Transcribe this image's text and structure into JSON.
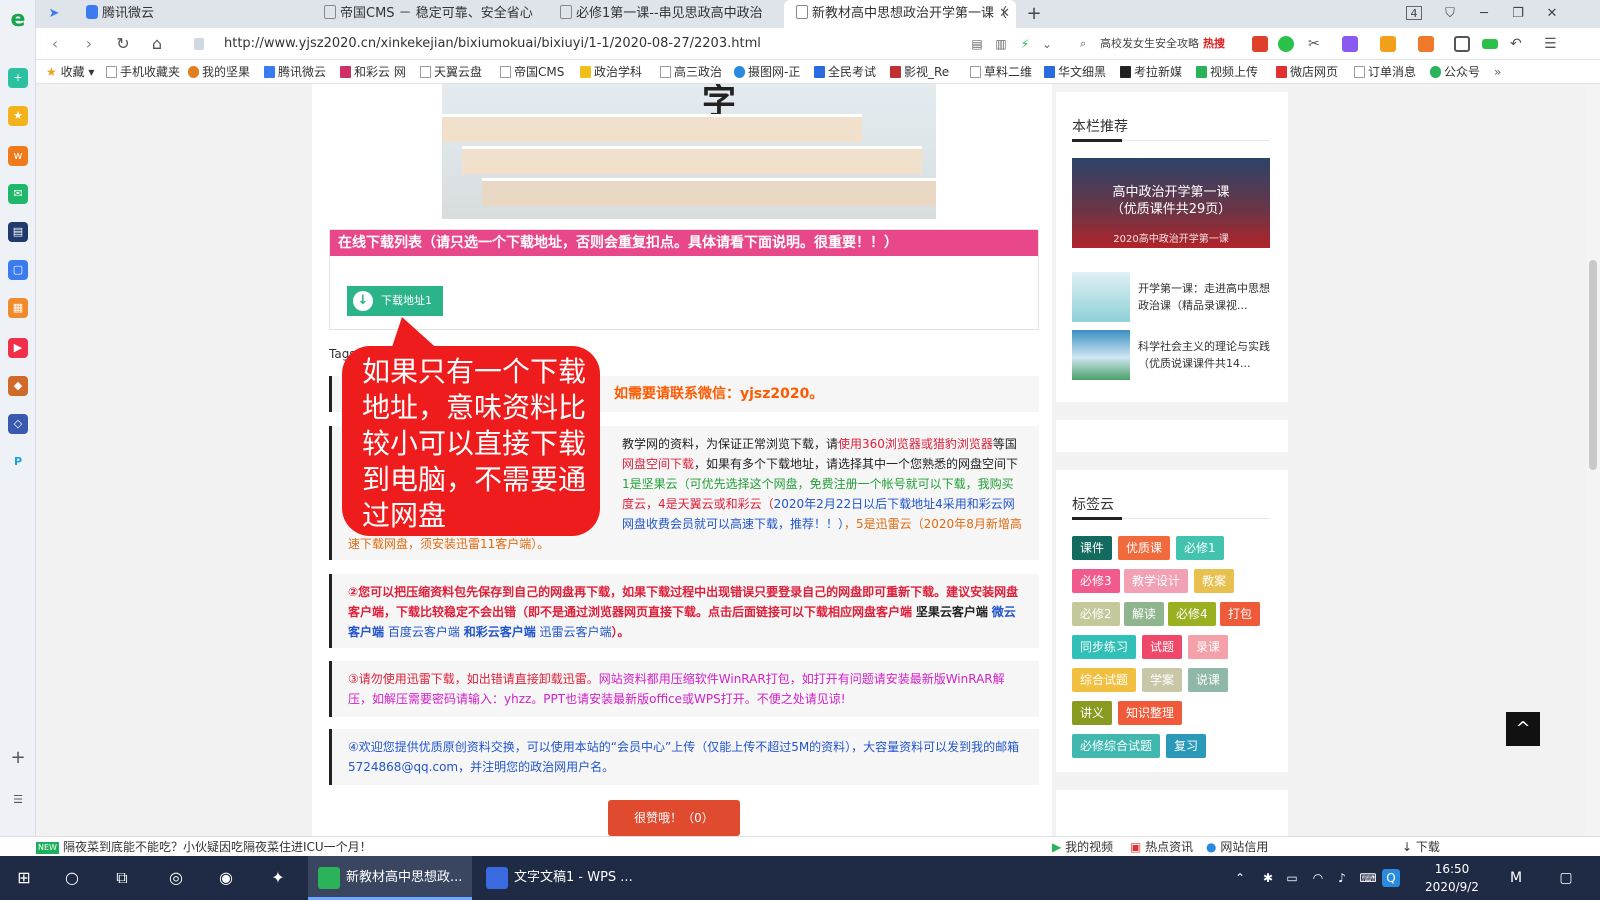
{
  "browser": {
    "tabs": [
      {
        "label": "腾讯微云"
      },
      {
        "label": "帝国CMS － 稳定可靠、安全省心"
      },
      {
        "label": "必修1第一课--串见思政高中政治"
      },
      {
        "label": "新教材高中思想政治开学第一课（"
      }
    ],
    "tab_count_badge": "4",
    "url": "http://www.yjsz2020.cn/xinkekejian/bixiumokuai/bixiuyi/1-1/2020-08-27/2203.html",
    "search_text": "高校发女生安全攻略",
    "search_hot": "热搜",
    "bookmarks": [
      "收藏",
      "手机收藏夹",
      "我的坚果",
      "腾讯微云",
      "和彩云 网",
      "天翼云盘",
      "帝国CMS",
      "政治学科",
      "高三政治",
      "摄图网-正",
      "全民考试",
      "影视_Re",
      "草料二维",
      "华文细黑",
      "考拉新媒",
      "视频上传",
      "微店网页",
      "订单消息",
      "公众号"
    ],
    "more_bookmarks": "»"
  },
  "page": {
    "download_header": "在线下载列表（请只选一个下载地址，否则会重复扣点。具体请看下面说明。很重要！！）",
    "download_button": "下载地址1",
    "tags_label": "Tags",
    "note_wechat": "如需要请联系微信：yjsz2020。",
    "note1": {
      "p1": "教学网的资料，为保证正常浏览下载，请",
      "p2": "使用360浏览器或猎豹浏览器",
      "p3": "等国",
      "p4": "网盘空间下载",
      "p5": "，如果有多个下载地址，请选择其中一个您熟悉的网盘空间下",
      "p6": "1是坚果云（可优先选择这个网盘，免费注册一个帐号就可以下载，我购买",
      "p7": "度云，4是天翼云或和彩云（",
      "p8": "2020年2月22日以后下载地址4采用和彩云网",
      "p9": "网盘收费会员就可以高速下载，推荐！！）",
      "p10": "，5是迅雷云（2020年8月新增高",
      "p11": "速下载网盘，须安装迅雷11客户端）。"
    },
    "note2": {
      "t1": "②您可以把压缩资料包先保存到自己的网盘再下载，如果下载过程中出现错误只要登录自己的网盘即可重新下载。建议安装网盘客户端，下载比较稳定不会出错（即不是通过浏览器网页直接下载。点击后面链接可以下载相应网盘客户端",
      "l1": "坚果云客户端",
      "l2": "微云客户端",
      "l3": "百度云客户端",
      "l4": "和彩云客户端",
      "l5": "迅雷云客户端",
      "t2": "）。"
    },
    "note3": {
      "t1": "③请勿使用迅雷下载，如出错请直接卸载迅雷。",
      "t2": "网站资料都用压缩软件WinRAR打包，如打开有问题请安装最新版WinRAR解压，如解压需要密码请输入：yhzz。PPT也请安装最新版office或WPS打开。不便之处请见谅!"
    },
    "note4": {
      "t1": "④欢迎您提供优质原创资料交换，可以使用本站的“会员中心”上传（仅能上传不超过5M的资料），大容量资料可以发到我的邮箱5724868@qq.com，并注明您的政治网用户名。"
    },
    "bubble_text": "如果只有一个下载地址，意味资料比较小可以直接下载到电脑，不需要通过网盘",
    "bottom_button": "很赞哦！（0）"
  },
  "sidebar": {
    "recommend_title": "本栏推荐",
    "featured_line1": "高中政治开学第一课",
    "featured_line2": "（优质课件共29页）",
    "featured_caption": "2020高中政治开学第一课",
    "rec1": "开学第一课：走进高中思想政治课（精品录课视...",
    "rec2": "科学社会主义的理论与实践（优质说课课件共14...",
    "tags_title": "标签云",
    "tags": [
      {
        "label": "课件",
        "color": "#136a5e"
      },
      {
        "label": "优质课",
        "color": "#f06a3c"
      },
      {
        "label": "必修1",
        "color": "#41c3b0"
      },
      {
        "label": "必修3",
        "color": "#f05a8c"
      },
      {
        "label": "教学设计",
        "color": "#f2a0b4"
      },
      {
        "label": "教案",
        "color": "#e8c050"
      },
      {
        "label": "必修2",
        "color": "#c4c89a"
      },
      {
        "label": "解读",
        "color": "#8fb58f"
      },
      {
        "label": "必修4",
        "color": "#9ab020"
      },
      {
        "label": "打包",
        "color": "#ef5a3a"
      },
      {
        "label": "同步练习",
        "color": "#30c0b8"
      },
      {
        "label": "试题",
        "color": "#f0486a"
      },
      {
        "label": "录课",
        "color": "#f3a0a8"
      },
      {
        "label": "综合试题",
        "color": "#f2c040"
      },
      {
        "label": "学案",
        "color": "#c8c8a8"
      },
      {
        "label": "说课",
        "color": "#8fb8a8"
      },
      {
        "label": "讲义",
        "color": "#8a9a20"
      },
      {
        "label": "知识整理",
        "color": "#f05a3a"
      },
      {
        "label": "必修综合试题",
        "color": "#40b8b0"
      },
      {
        "label": "复习",
        "color": "#2a9ab8"
      }
    ]
  },
  "statusbar": {
    "new_badge": "NEW",
    "news": "隔夜菜到底能不能吃？小伙疑因吃隔夜菜住进ICU一个月！",
    "my_video": "我的视频",
    "hot_news": "热点资讯",
    "site_credit": "网站信用",
    "download": "下载"
  },
  "taskbar": {
    "task1": "新教材高中思想政...",
    "task2": "文字文稿1 - WPS ...",
    "time": "16:50",
    "date": "2020/9/2"
  }
}
